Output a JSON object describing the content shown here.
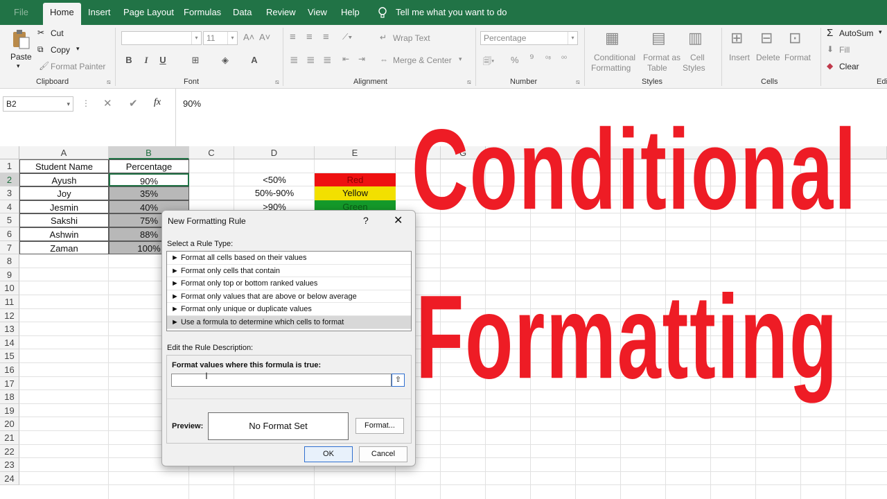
{
  "tabs": [
    "File",
    "Home",
    "Insert",
    "Page Layout",
    "Formulas",
    "Data",
    "Review",
    "View",
    "Help"
  ],
  "tell_me": "Tell me what you want to do",
  "ribbon": {
    "clipboard": {
      "paste": "Paste",
      "cut": "Cut",
      "copy": "Copy",
      "format_painter": "Format Painter",
      "label": "Clipboard"
    },
    "font": {
      "size": "11",
      "label": "Font"
    },
    "alignment": {
      "wrap_text": "Wrap Text",
      "merge_center": "Merge & Center",
      "label": "Alignment"
    },
    "number": {
      "format": "Percentage",
      "label": "Number"
    },
    "styles": {
      "conditional": "Conditional",
      "formatting": "Formatting",
      "format_as": "Format as",
      "table": "Table",
      "cell": "Cell",
      "cell_styles": "Styles",
      "label": "Styles"
    },
    "cells": {
      "insert": "Insert",
      "delete": "Delete",
      "format": "Format",
      "label": "Cells"
    },
    "editing": {
      "autosum": "AutoSum",
      "fill": "Fill",
      "clear": "Clear",
      "label": "Edi"
    }
  },
  "formula_bar": {
    "name_box": "B2",
    "fx": "fx",
    "value": "90%"
  },
  "columns": [
    "A",
    "B",
    "C",
    "D",
    "E",
    "G"
  ],
  "rows": [
    "1",
    "2",
    "3",
    "4",
    "5",
    "6",
    "7",
    "8",
    "9",
    "10",
    "11",
    "12",
    "13",
    "14",
    "15",
    "16",
    "17",
    "18",
    "19",
    "20",
    "21",
    "22",
    "23",
    "24"
  ],
  "table": {
    "header_a": "Student Name",
    "header_b": "Percentage",
    "students": [
      {
        "name": "Ayush",
        "pct": "90%"
      },
      {
        "name": "Joy",
        "pct": "35%"
      },
      {
        "name": "Jesmin",
        "pct": "40%"
      },
      {
        "name": "Sakshi",
        "pct": "75%"
      },
      {
        "name": "Ashwin",
        "pct": "88%"
      },
      {
        "name": "Zaman",
        "pct": "100%"
      }
    ]
  },
  "legend": [
    {
      "range": "<50%",
      "color_label": "Red",
      "color": "#ee1111"
    },
    {
      "range": "50%-90%",
      "color_label": "Yellow",
      "color": "#f2e000"
    },
    {
      "range": ">90%",
      "color_label": "Green",
      "color": "#149a2a"
    }
  ],
  "overlay": {
    "line1": "Conditional",
    "line2": "Formatting",
    "color": "#ee1c25"
  },
  "dialog": {
    "title": "New Formatting Rule",
    "help": "?",
    "close": "✕",
    "select_label": "Select a Rule Type:",
    "rule_types": [
      "► Format all cells based on their values",
      "► Format only cells that contain",
      "► Format only top or bottom ranked values",
      "► Format only values that are above or below average",
      "► Format only unique or duplicate values",
      "► Use a formula to determine which cells to format"
    ],
    "edit_label": "Edit the Rule Description:",
    "formula_label": "Format values where this formula is true:",
    "formula_value": "",
    "preview_label": "Preview:",
    "preview_text": "No Format Set",
    "format_button": "Format...",
    "ok": "OK",
    "cancel": "Cancel"
  },
  "accent": "#217346"
}
